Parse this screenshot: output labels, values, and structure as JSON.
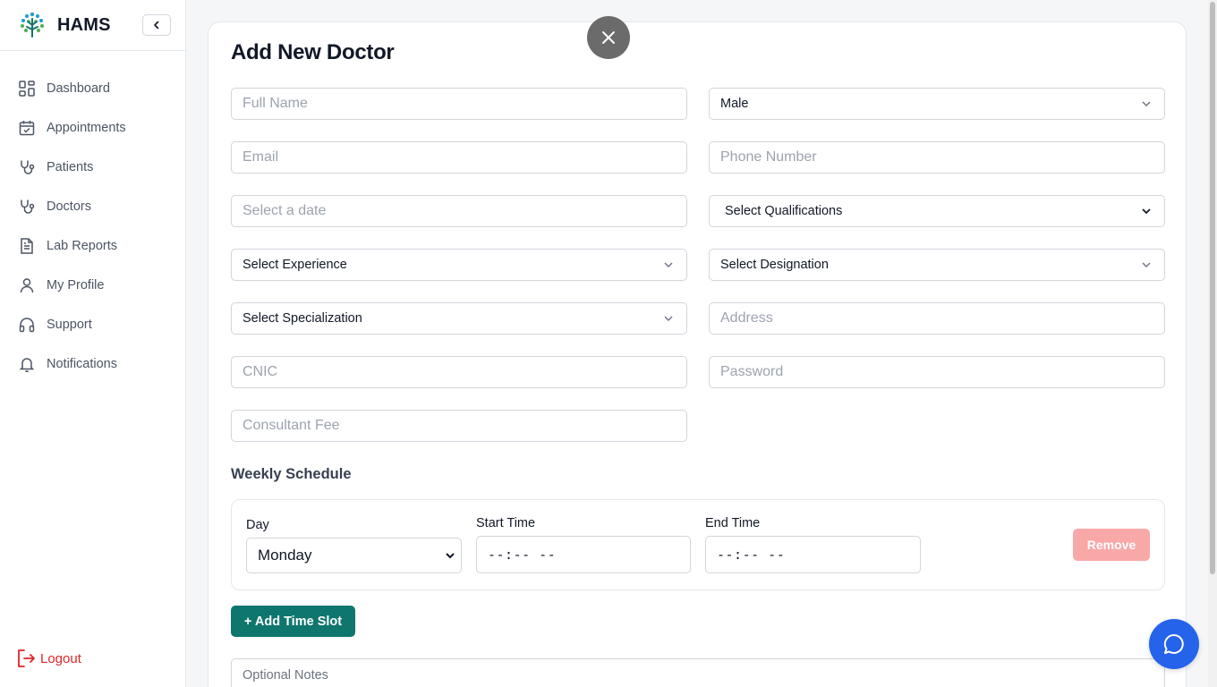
{
  "brand": {
    "name": "HAMS"
  },
  "sidebar": {
    "items": [
      {
        "label": "Dashboard",
        "icon": "dashboard-icon"
      },
      {
        "label": "Appointments",
        "icon": "calendar-check-icon"
      },
      {
        "label": "Patients",
        "icon": "stethoscope-icon"
      },
      {
        "label": "Doctors",
        "icon": "stethoscope-icon"
      },
      {
        "label": "Lab Reports",
        "icon": "file-text-icon"
      },
      {
        "label": "My Profile",
        "icon": "user-icon"
      },
      {
        "label": "Support",
        "icon": "headphones-icon"
      },
      {
        "label": "Notifications",
        "icon": "bell-icon"
      }
    ],
    "logout": "Logout"
  },
  "form": {
    "title": "Add New Doctor",
    "full_name_placeholder": "Full Name",
    "gender_value": "Male",
    "email_placeholder": "Email",
    "phone_placeholder": "Phone Number",
    "date_placeholder": "Select a date",
    "qualifications_value": "Select Qualifications",
    "experience_value": "Select Experience",
    "designation_value": "Select Designation",
    "specialization_value": "Select Specialization",
    "address_placeholder": "Address",
    "cnic_placeholder": "CNIC",
    "password_placeholder": "Password",
    "fee_placeholder": "Consultant Fee"
  },
  "schedule": {
    "title": "Weekly Schedule",
    "day_label": "Day",
    "day_value": "Monday",
    "start_label": "Start Time",
    "start_value": "--:-- --",
    "end_label": "End Time",
    "end_value": "--:-- --",
    "remove_label": "Remove",
    "add_slot_label": "+ Add Time Slot"
  },
  "notes": {
    "placeholder": "Optional Notes"
  },
  "colors": {
    "accent": "#0f766e",
    "danger": "#dc2626",
    "remove_bg": "#f9a8a8",
    "chat": "#2563eb"
  }
}
